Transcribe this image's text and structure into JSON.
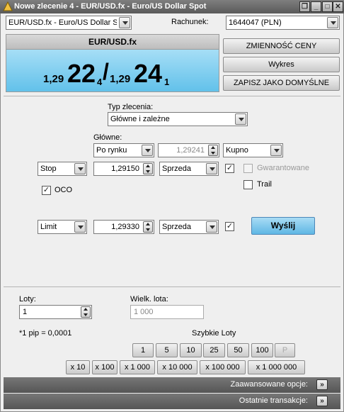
{
  "window": {
    "title": "Nowe zlecenie 4 - EUR/USD.fx - Euro/US Dollar Spot",
    "buttons": {
      "restore": "❐",
      "minimize": "_",
      "maximize": "□",
      "close": "✕"
    }
  },
  "top": {
    "instrument": "EUR/USD.fx - Euro/US Dollar Spot",
    "account_label": "Rachunek:",
    "account": "1644047 (PLN)"
  },
  "price": {
    "symbol": "EUR/USD.fx",
    "bid_small": "1,29",
    "bid_big": "22",
    "bid_sub": "4",
    "slash": "/",
    "ask_small": "1,29",
    "ask_big": "24",
    "ask_sub": "1"
  },
  "side_buttons": {
    "volatility": "ZMIENNOŚĆ CENY",
    "chart": "Wykres",
    "save_default": "ZAPISZ JAKO DOMYŚLNE"
  },
  "order": {
    "type_label": "Typ zlecenia:",
    "type_value": "Główne i zależne",
    "main_label": "Główne:",
    "main_type": "Po rynku",
    "main_price": "1,29241",
    "main_side": "Kupno",
    "stop_type": "Stop",
    "stop_price": "1,29150",
    "stop_side": "Sprzeda",
    "guaranteed_label": "Gwarantowane",
    "trail_label": "Trail",
    "oco_label": "OCO",
    "limit_type": "Limit",
    "limit_price": "1,29330",
    "limit_side": "Sprzeda",
    "send_label": "Wyślij",
    "checked_mark": "✓"
  },
  "lots": {
    "lots_label": "Loty:",
    "lots_value": "1",
    "lot_size_label": "Wielk. lota:",
    "lot_size_value": "1 000",
    "pip_info": "*1 pip = 0,0001",
    "quick_label": "Szybkie Loty",
    "quick_row1": [
      "1",
      "5",
      "10",
      "25",
      "50",
      "100",
      "P"
    ],
    "quick_row2": [
      "x 10",
      "x 100",
      "x 1 000",
      "x 10 000",
      "x 100 000",
      "x 1 000 000"
    ]
  },
  "footer": {
    "advanced": "Zaawansowane opcje:",
    "recent": "Ostatnie transakcje:",
    "expand_glyph": "»"
  }
}
